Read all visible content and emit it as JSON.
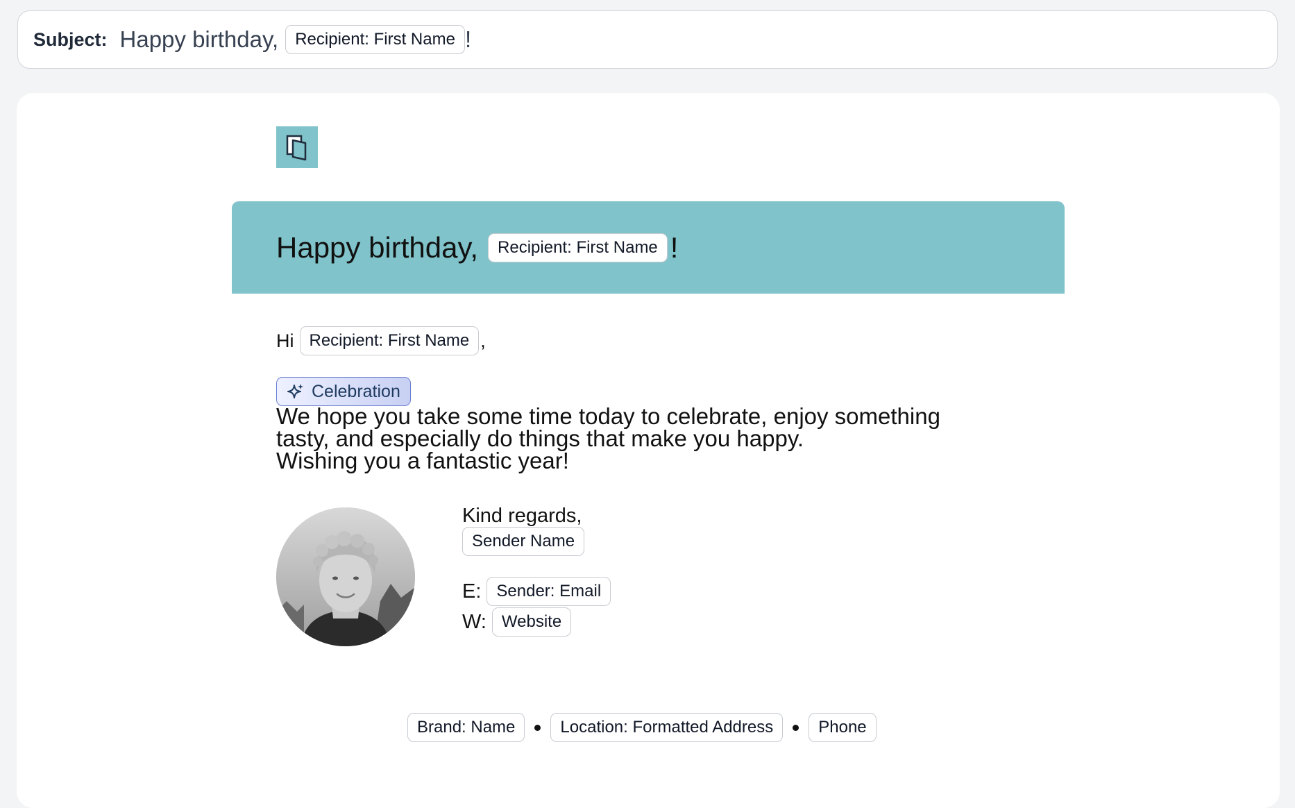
{
  "subject": {
    "label": "Subject:",
    "text": "Happy birthday,",
    "chip": "Recipient: First Name",
    "suffix": "!"
  },
  "email": {
    "logo_icon": "document-pages-icon",
    "hero": {
      "text": "Happy birthday,",
      "chip": "Recipient: First Name",
      "suffix": "!"
    },
    "greeting": {
      "hi": "Hi",
      "chip": "Recipient: First Name",
      "suffix": ","
    },
    "tag": {
      "icon": "sparkle-icon",
      "label": "Celebration"
    },
    "message": [
      "We hope you take some time today to celebrate, enjoy something",
      "tasty, and especially do things that make you happy.",
      "Wishing you a fantastic year!"
    ],
    "signature": {
      "signoff": "Kind regards,",
      "sender_chip": "Sender Name",
      "email_label": "E:",
      "email_chip": "Sender: Email",
      "website_label": "W:",
      "website_chip": "Website"
    },
    "footer": {
      "brand_chip": "Brand: Name",
      "location_chip": "Location: Formatted Address",
      "phone_chip": "Phone"
    }
  },
  "colors": {
    "accent": "#80c3ca",
    "tag_border": "#6b7fd1"
  }
}
